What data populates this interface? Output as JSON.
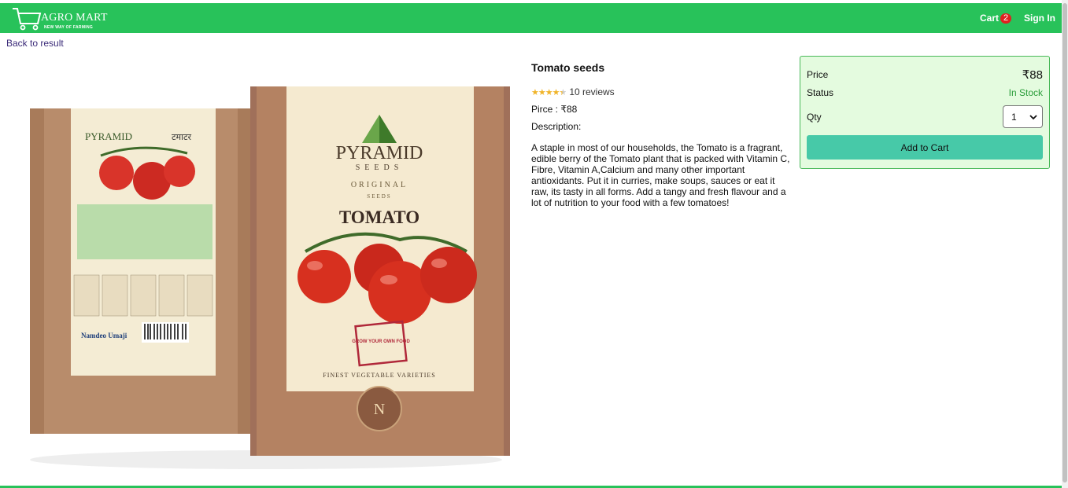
{
  "header": {
    "brand": "AGRO MART",
    "tagline": "NEW WAY OF FARMING",
    "cart_label": "Cart",
    "cart_count": "2",
    "signin_label": "Sign In"
  },
  "nav": {
    "back_label": "Back to result"
  },
  "product": {
    "name": "Tomato seeds",
    "rating": 4.5,
    "reviews_text": "10 reviews",
    "price_line": "Pirce : ₹88",
    "description_label": "Description:",
    "description": "A staple in most of our households, the Tomato is a fragrant, edible berry of the Tomato plant that is packed with Vitamin C, Fibre, Vitamin A,Calcium and many other important antioxidants. Put it in curries, make soups, sauces or eat it raw, its tasty in all forms. Add a tangy and fresh flavour and a lot of nutrition to your food with a few tomatoes!"
  },
  "packaging": {
    "brand": "PYRAMID",
    "brand_sub": "SEEDS",
    "original": "ORIGINAL",
    "seeds": "SEEDS",
    "variety": "TOMATO",
    "hindi": "टमाटर",
    "grow_own": "GROW YOUR OWN FOOD",
    "footer": "FINEST VEGETABLE VARIETIES",
    "maker": "Namdeo Umaji"
  },
  "buybox": {
    "price_label": "Price",
    "price_value": "₹88",
    "status_label": "Status",
    "status_value": "In Stock",
    "qty_label": "Qty",
    "qty_value": "1",
    "add_label": "Add to Cart"
  },
  "colors": {
    "nav_green": "#28c25a",
    "buybox_bg": "#e4fbdf",
    "button": "#47c9a8",
    "stock_green": "#2a9d3a",
    "badge_red": "#e02020",
    "star": "#f0b429"
  }
}
